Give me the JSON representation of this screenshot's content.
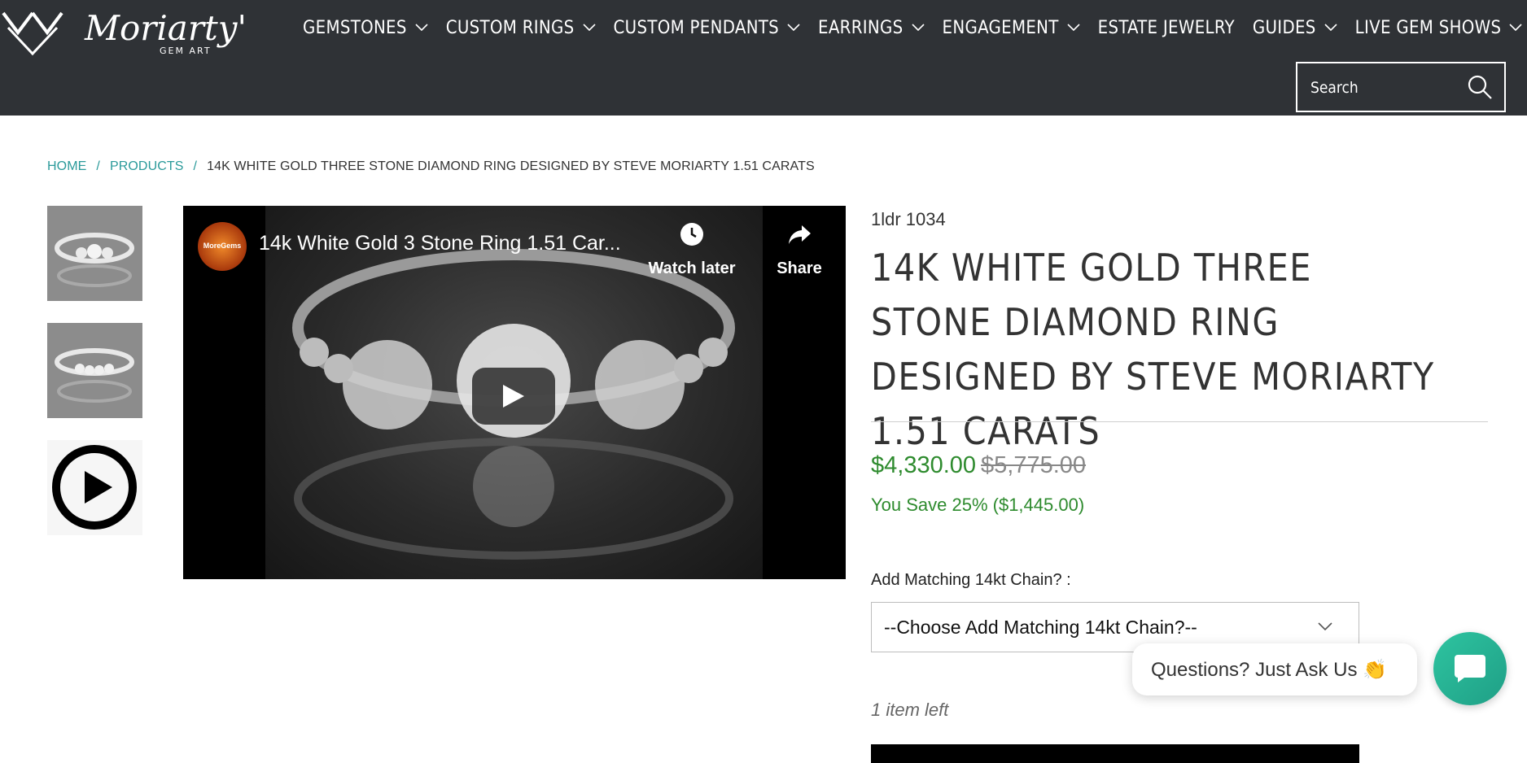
{
  "header": {
    "logo_text": "Moriarty's",
    "logo_subtext": "GEM ART",
    "nav": [
      {
        "label": "GEMSTONES",
        "has_dropdown": true
      },
      {
        "label": "CUSTOM RINGS",
        "has_dropdown": true
      },
      {
        "label": "CUSTOM PENDANTS",
        "has_dropdown": true
      },
      {
        "label": "EARRINGS",
        "has_dropdown": true
      },
      {
        "label": "ENGAGEMENT",
        "has_dropdown": true
      },
      {
        "label": "ESTATE JEWELRY",
        "has_dropdown": false
      },
      {
        "label": "GUIDES",
        "has_dropdown": true
      },
      {
        "label": "LIVE GEM SHOWS",
        "has_dropdown": true
      }
    ],
    "search_placeholder": "Search",
    "search_icon": "search-icon"
  },
  "breadcrumb": {
    "home": "HOME",
    "separator": "/",
    "products": "PRODUCTS",
    "current": "14K WHITE GOLD THREE STONE DIAMOND RING DESIGNED BY STEVE MORIARTY 1.51 CARATS"
  },
  "gallery": {
    "thumbnails": [
      "ring-photo-1",
      "ring-photo-2",
      "play-video-icon"
    ]
  },
  "video": {
    "title": "14k White Gold 3 Stone Ring 1.51 Car...",
    "channel": "MoreGems",
    "watch_later": "Watch later",
    "share": "Share"
  },
  "product": {
    "sku": "1ldr 1034",
    "title": "14K WHITE GOLD THREE STONE DIAMOND RING DESIGNED BY STEVE MORIARTY 1.51 CARATS",
    "price": "$4,330.00",
    "compare_price": "$5,775.00",
    "savings": "You Save 25% ($1,445.00)",
    "option_label": "Add Matching 14kt Chain? :",
    "option_selected": "--Choose Add Matching 14kt Chain?--",
    "stock": "1 item left"
  },
  "chat": {
    "prompt": "Questions? Just Ask Us 👏"
  },
  "colors": {
    "header_bg": "#2f3236",
    "link_teal": "#2a9a9a",
    "price_green": "#2e8b2e",
    "chat_teal": "#2ec4a0"
  }
}
